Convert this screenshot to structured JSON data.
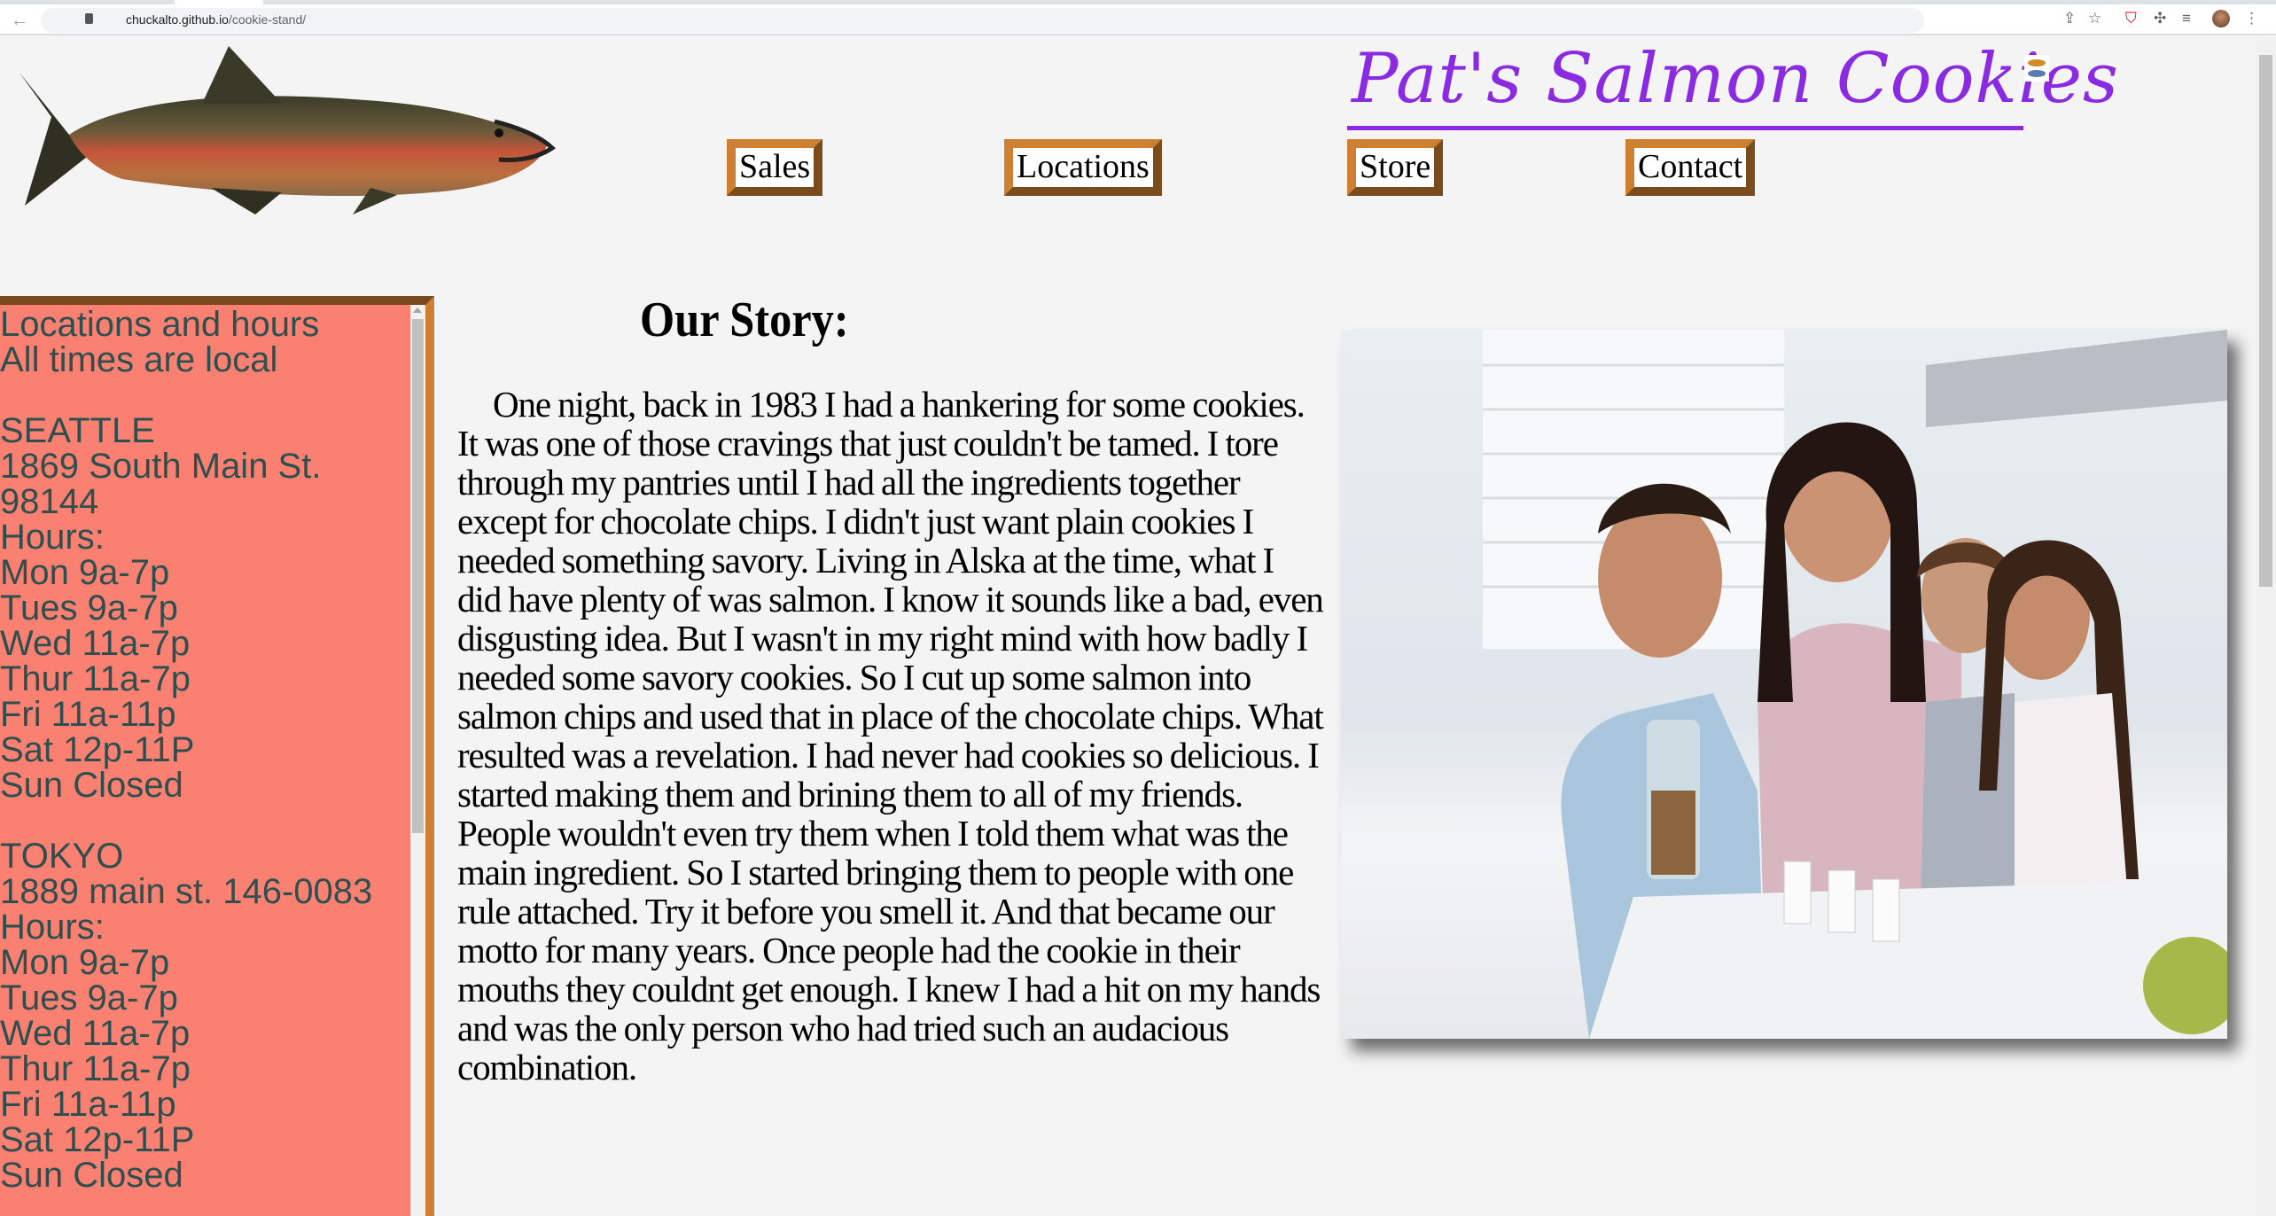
{
  "browser": {
    "url_host": "chuckalto.github.io",
    "url_path": "/cookie-stand/",
    "icons": [
      "back-icon",
      "forward-icon",
      "reload-icon",
      "lock-icon",
      "share-icon",
      "star-icon",
      "shield-icon",
      "extension-icon",
      "media-icon",
      "avatar",
      "menu-icon"
    ]
  },
  "header": {
    "title": "Pat's Salmon Cookies",
    "logo": "salmon-fish-image"
  },
  "nav": [
    {
      "label": "Sales"
    },
    {
      "label": "Locations"
    },
    {
      "label": "Store"
    },
    {
      "label": "Contact"
    }
  ],
  "sidebar": {
    "heading": "Locations and hours",
    "subheading": "All times are local",
    "locations": [
      {
        "city": "SEATTLE",
        "address": "1869 South Main St.",
        "zip": "98144",
        "hours_label": "Hours:",
        "hours": [
          "Mon 9a-7p",
          "Tues 9a-7p",
          "Wed 11a-7p",
          "Thur 11a-7p",
          "Fri 11a-11p",
          "Sat 12p-11P",
          "Sun Closed"
        ]
      },
      {
        "city": "TOKYO",
        "address": "1889 main st. 146-0083",
        "hours_label": "Hours:",
        "hours": [
          "Mon 9a-7p",
          "Tues 9a-7p",
          "Wed 11a-7p",
          "Thur 11a-7p",
          "Fri 11a-11p",
          "Sat 12p-11P",
          "Sun Closed"
        ]
      }
    ]
  },
  "main": {
    "title": "Our Story:",
    "photo": "family-with-cookies-and-milk-photo",
    "story": "One night, back in 1983 I had a hankering for some cookies. It was one of those cravings that just couldn't be tamed. I tore through my pantries until I had all the ingredients together except for chocolate chips. I didn't just want plain cookies I needed something savory. Living in Alska at the time, what I did have plenty of was salmon. I know it sounds like a bad, even disgusting idea. But I wasn't in my right mind with how badly I needed some savory cookies. So I cut up some salmon into salmon chips and used that in place of the chocolate chips. What resulted was a revelation. I had never had cookies so delicious. I started making them and brining them to all of my friends. People wouldn't even try them when I told them what was the main ingredient. So I started bringing them to people with one rule attached. Try it before you smell it. And that became our motto for many years. Once people had the cookie in their mouths they couldnt get enough. I knew I had a hit on my hands and was the only person who had tried such an audacious combination."
  },
  "colors": {
    "title": "#8a2be2",
    "sidebar_bg": "#fa8072",
    "sidebar_text": "#2f4f4f",
    "border_dark": "#7a4a1e",
    "border_light": "#cd7f32"
  }
}
